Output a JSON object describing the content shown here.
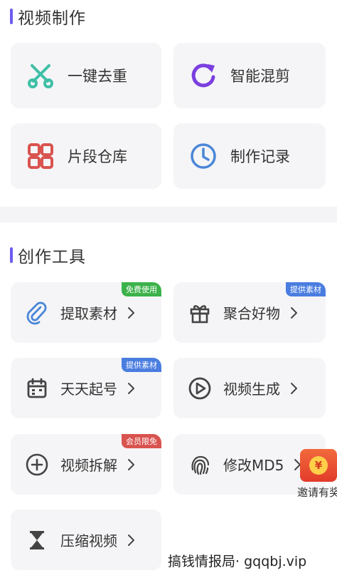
{
  "video_making": {
    "title": "视频制作",
    "items": [
      {
        "label": "一键去重",
        "icon": "scissors-icon"
      },
      {
        "label": "智能混剪",
        "icon": "refresh-icon"
      },
      {
        "label": "片段仓库",
        "icon": "grid-icon"
      },
      {
        "label": "制作记录",
        "icon": "clock-icon"
      }
    ]
  },
  "creation_tools": {
    "title": "创作工具",
    "items": [
      {
        "label": "提取素材",
        "badge": "免费使用",
        "icon": "paperclip-icon"
      },
      {
        "label": "聚合好物",
        "badge": "提供素材",
        "icon": "gift-icon"
      },
      {
        "label": "天天起号",
        "badge": "提供素材",
        "icon": "calendar-icon"
      },
      {
        "label": "视频生成",
        "badge": "",
        "icon": "play-circle-icon"
      },
      {
        "label": "视频拆解",
        "badge": "会员限免",
        "icon": "plus-circle-icon"
      },
      {
        "label": "修改MD5",
        "badge": "",
        "icon": "fingerprint-icon"
      },
      {
        "label": "压缩视频",
        "badge": "",
        "icon": "hourglass-icon"
      }
    ]
  },
  "reward": {
    "label": "邀请有奖",
    "coin": "¥"
  },
  "watermark": "搞钱情报局· gqqbj.vip",
  "colors": {
    "accent": "#6f5cf0",
    "badge_green": "#3cb24a",
    "badge_blue": "#4a7de0",
    "badge_red": "#d9534f",
    "scissors": "#3fbfa6",
    "refresh": "#7b3fe0",
    "grid": "#d9534f",
    "clock": "#4a86d8"
  }
}
